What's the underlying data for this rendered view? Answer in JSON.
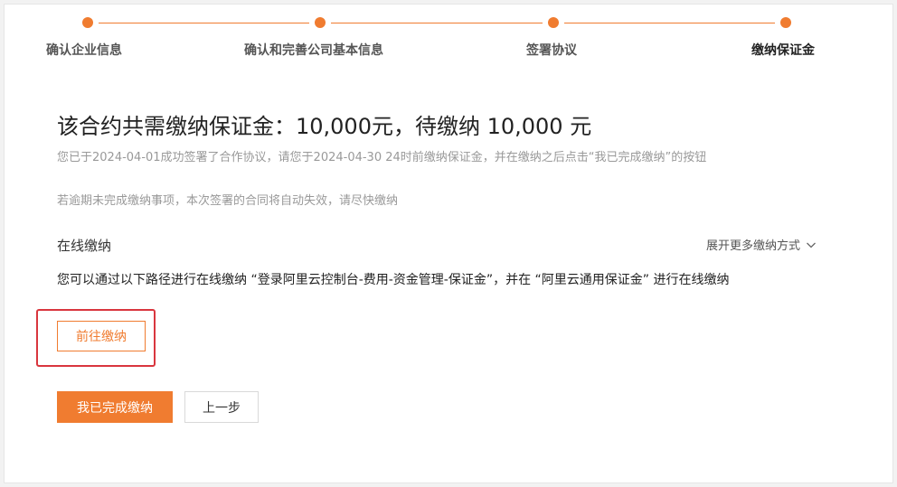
{
  "steps": [
    {
      "label": "确认企业信息"
    },
    {
      "label": "确认和完善公司基本信息"
    },
    {
      "label": "签署协议"
    },
    {
      "label": "缴纳保证金"
    }
  ],
  "header": {
    "title": "该合约共需缴纳保证金：10,000元，待缴纳 10,000 元"
  },
  "notes": {
    "line1": "您已于2024-04-01成功签署了合作协议，请您于2024-04-30 24时前缴纳保证金，并在缴纳之后点击“我已完成缴纳”的按钮",
    "line2": "若逾期未完成缴纳事项，本次签署的合同将自动失效，请尽快缴纳"
  },
  "online": {
    "title": "在线缴纳",
    "expand_label": "展开更多缴纳方式",
    "description": "您可以通过以下路径进行在线缴纳 “登录阿里云控制台-费用-资金管理-保证金”，并在 “阿里云通用保证金” 进行在线缴纳",
    "goto_label": "前往缴纳"
  },
  "actions": {
    "done_label": "我已完成缴纳",
    "prev_label": "上一步"
  },
  "colors": {
    "accent": "#f07c30",
    "highlight": "#d9363e"
  },
  "icons": {
    "step": "circle-dot",
    "expand": "chevron-down-icon"
  }
}
